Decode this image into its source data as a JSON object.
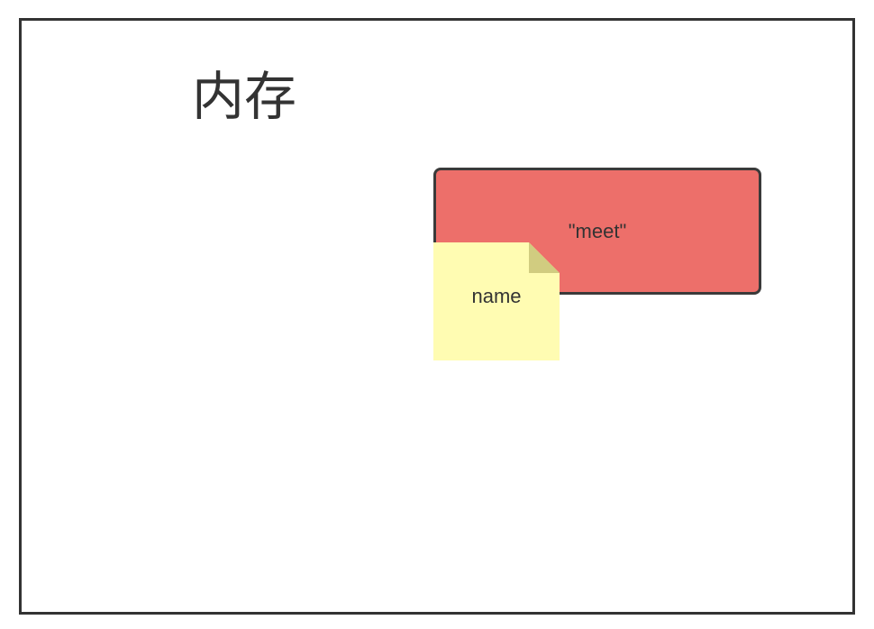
{
  "diagram": {
    "title": "内存",
    "value_box": {
      "label": "\"meet\"",
      "fill": "#ed6f6a"
    },
    "note": {
      "label": "name",
      "fill": "#fffcb2",
      "fold_fill": "#d1cc80"
    }
  }
}
